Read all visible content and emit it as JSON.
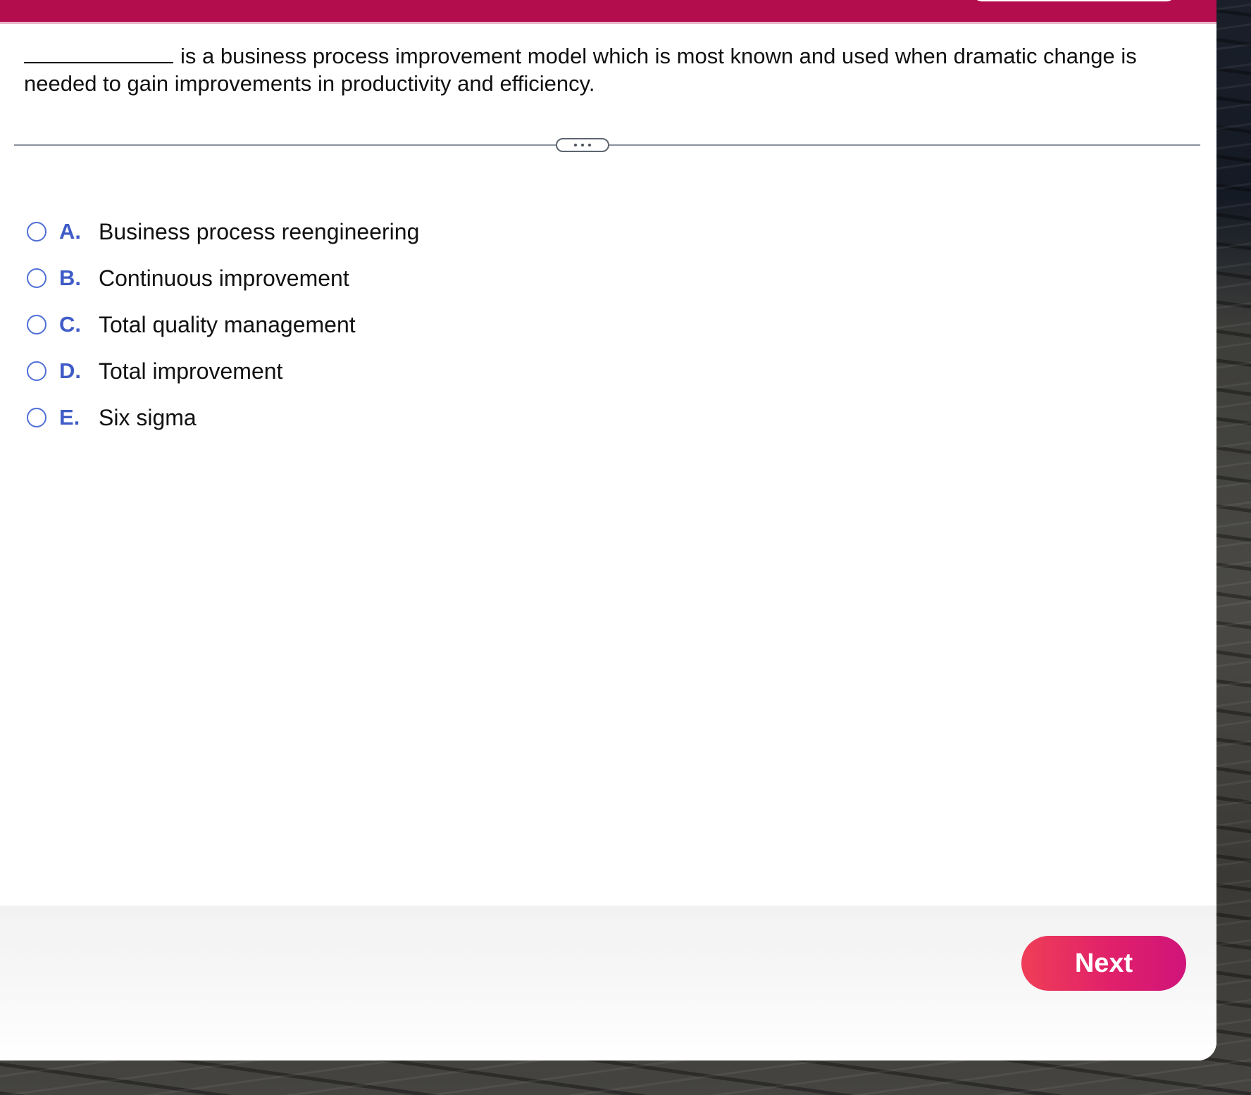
{
  "question": {
    "blank": "____________",
    "text": "is a business process improvement model which is most known and used when dramatic change is needed to gain improvements in productivity and efficiency."
  },
  "divider": {
    "more_icon": "more-horizontal-icon"
  },
  "options": [
    {
      "letter": "A.",
      "text": "Business process reengineering"
    },
    {
      "letter": "B.",
      "text": "Continuous improvement"
    },
    {
      "letter": "C.",
      "text": "Total quality management"
    },
    {
      "letter": "D.",
      "text": "Total improvement"
    },
    {
      "letter": "E.",
      "text": "Six sigma"
    }
  ],
  "footer": {
    "next_label": "Next"
  },
  "colors": {
    "brand": "#b30d4e",
    "option_letter": "#3e5bc7",
    "radio_border": "#4f6fd6",
    "next_gradient_start": "#ef3e57",
    "next_gradient_end": "#d0147a"
  }
}
